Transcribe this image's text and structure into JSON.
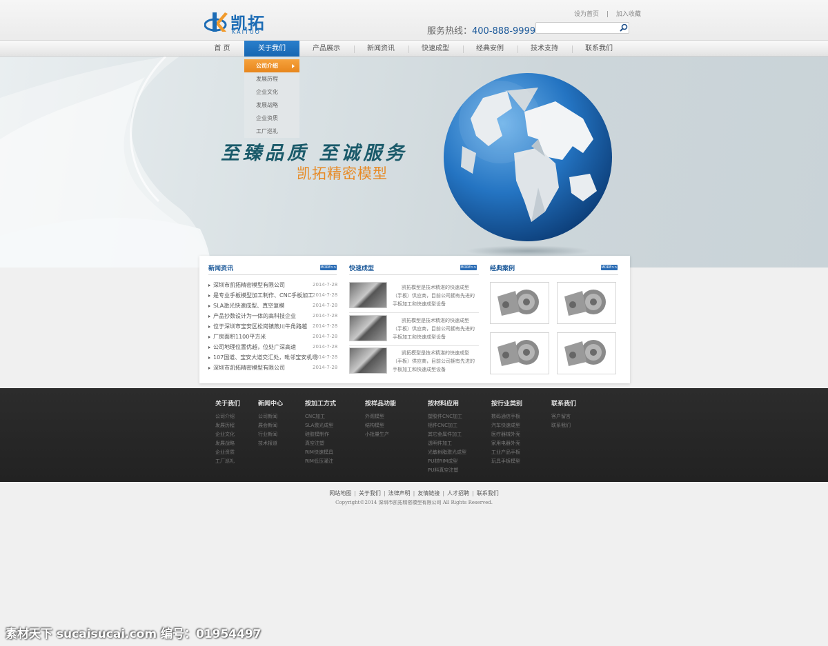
{
  "header": {
    "logo_cn": "凯拓",
    "logo_en": "KAITUO",
    "top_links": [
      "设为首页",
      "|",
      "加入收藏"
    ],
    "hotline_label": "服务热线：",
    "hotline_number": "400-888-9999",
    "search_placeholder": ""
  },
  "nav": {
    "items": [
      "首 页",
      "关于我们",
      "产品展示",
      "新闻资讯",
      "快速成型",
      "经典安例",
      "技术支持",
      "联系我们"
    ],
    "active": "关于我们"
  },
  "dropdown": {
    "items": [
      "公司介绍",
      "发展历程",
      "企业文化",
      "发展战略",
      "企业资质",
      "工厂巡礼"
    ]
  },
  "banner": {
    "slogan1": "至臻品质  至诚服务",
    "slogan2": "凯拓精密模型"
  },
  "news": {
    "title": "新闻资讯",
    "more": "MORE>>",
    "rows": [
      {
        "title": "深圳市凯拓精密模型有限公司",
        "date": "2014-7-28"
      },
      {
        "title": "是专业手板模型加工制作、CNC手板加工",
        "date": "2014-7-28"
      },
      {
        "title": "SLA激光快速成型、真空复模",
        "date": "2014-7-28"
      },
      {
        "title": "产品抄数设计为一体的高科技企业",
        "date": "2014-7-28"
      },
      {
        "title": "位于深圳市宝安区松岗镇燕川牛角路越",
        "date": "2014-7-28"
      },
      {
        "title": "厂房面积1100平方米",
        "date": "2014-7-28"
      },
      {
        "title": "公司地理位置优越，位处广深高速",
        "date": "2014-7-28"
      },
      {
        "title": "107国道、宝安大道交汇处，毗邻宝安机场",
        "date": "2014-7-28"
      },
      {
        "title": "深圳市凯拓精密模型有限公司",
        "date": "2014-7-28"
      }
    ]
  },
  "rapid": {
    "title": "快速成型",
    "more": "MORE>>",
    "items": [
      {
        "text": "凯拓模型是技术精湛的快速成型（手板）供应商，目前公司拥有先进的手板加工和快速成型设备"
      },
      {
        "text": "凯拓模型是技术精湛的快速成型（手板）供应商，目前公司拥有先进的手板加工和快速成型设备"
      },
      {
        "text": "凯拓模型是技术精湛的快速成型（手板）供应商，目前公司拥有先进的手板加工和快速成型设备"
      }
    ]
  },
  "cases": {
    "title": "经典案例",
    "more": "MORE>>"
  },
  "footer": {
    "columns": [
      {
        "title": "关于我们",
        "items": [
          "公司介绍",
          "发展历程",
          "企业文化",
          "发展战略",
          "企业资质",
          "工厂巡礼"
        ]
      },
      {
        "title": "新闻中心",
        "items": [
          "公司新闻",
          "展会新闻",
          "行业新闻",
          "技术报道"
        ]
      },
      {
        "title": "按加工方式",
        "items": [
          "CNC加工",
          "SLA激光成型",
          "硅胶模制作",
          "真空注塑",
          "RIM快速模具",
          "RIM低压灌注"
        ]
      },
      {
        "title": "按样品功能",
        "items": [
          "外观模型",
          "结构模型",
          "小批量生产"
        ]
      },
      {
        "title": "按材料应用",
        "items": [
          "塑胶件CNC加工",
          "铝件CNC加工",
          "其它金属件加工",
          "透明件加工",
          "光敏树脂激光成型",
          "PU材RIM成型",
          "PU料真空注塑"
        ]
      },
      {
        "title": "按行业类别",
        "items": [
          "数码通信手板",
          "汽车快速成型",
          "医疗器械外壳",
          "家用电器外壳",
          "工业产品手板",
          "玩具手板模型"
        ]
      },
      {
        "title": "联系我们",
        "items": [
          "客户留言",
          "联系我们"
        ]
      }
    ],
    "bottom_links": [
      "网站地图",
      "关于我们",
      "法律声明",
      "友情链接",
      "人才招聘",
      "联系我们"
    ],
    "copyright": "Copyright©2014 深圳市凯拓精密模型有限公司 All Rights Reserved."
  },
  "watermark": "素材天下 sucaisucai.com  编号：01954497",
  "colors": {
    "brand_blue": "#1c6cb5",
    "nav_active": "#1565b0",
    "dropdown_active": "#e7861d",
    "slogan_orange": "#e78a25"
  }
}
